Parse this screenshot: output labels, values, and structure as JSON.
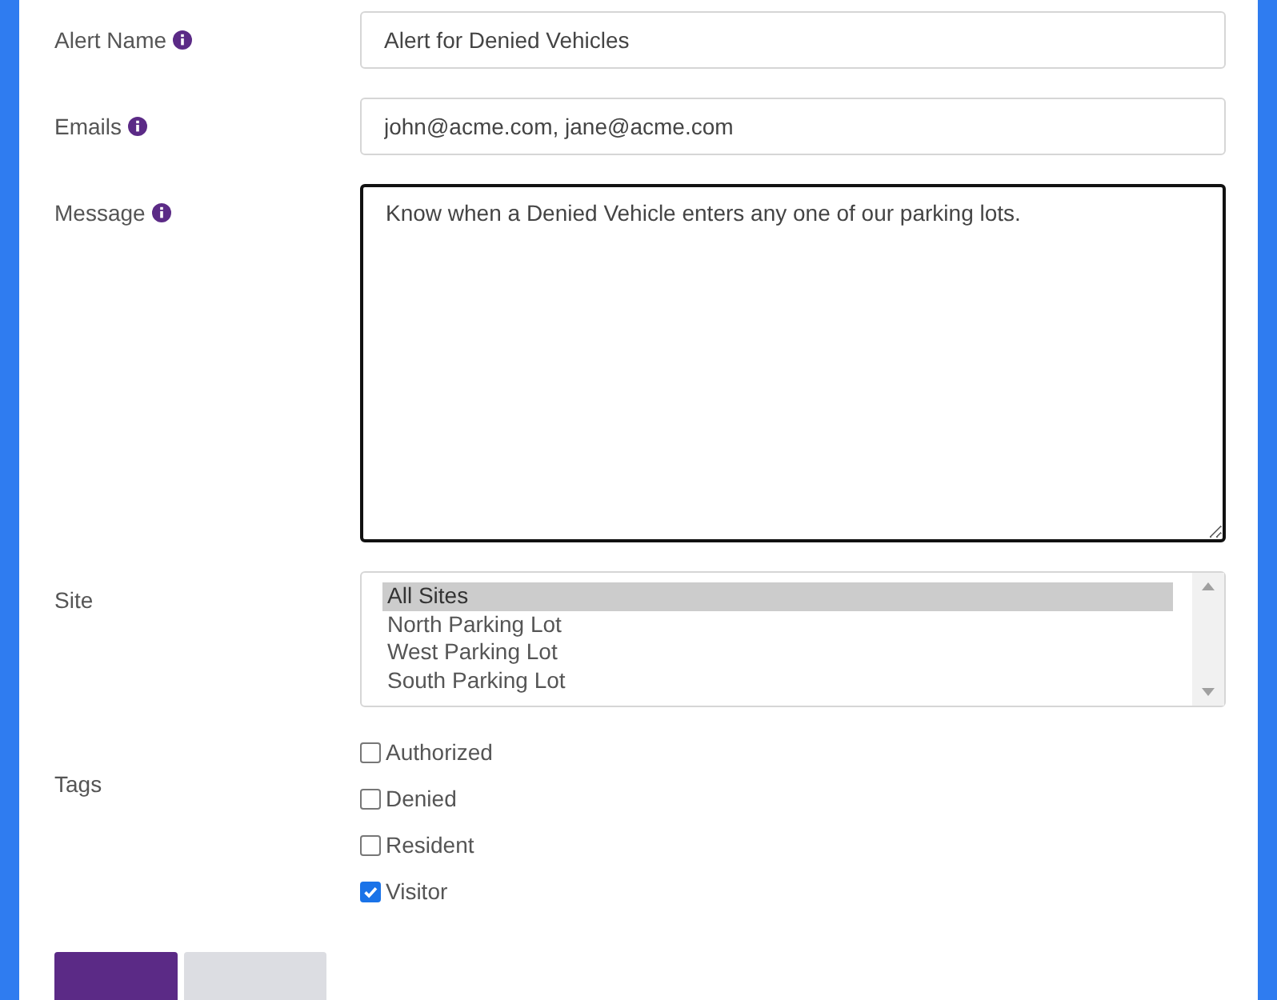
{
  "fields": [
    {
      "kind": "input",
      "label": "Alert Name",
      "info": true,
      "value": "Alert for Denied Vehicles",
      "focused": false
    },
    {
      "kind": "input",
      "label": "Emails",
      "info": true,
      "value": "john@acme.com, jane@acme.com",
      "focused": false
    },
    {
      "kind": "textarea",
      "label": "Message",
      "info": true,
      "value": "Know when a Denied Vehicle enters any one of our parking lots.",
      "focused": true
    },
    {
      "kind": "listbox",
      "label": "Site",
      "info": false,
      "options": [
        {
          "label": "All Sites",
          "selected": true
        },
        {
          "label": "North Parking Lot",
          "selected": false
        },
        {
          "label": "West Parking Lot",
          "selected": false
        },
        {
          "label": "South Parking Lot",
          "selected": false
        }
      ]
    },
    {
      "kind": "checkboxes",
      "label": "Tags",
      "info": false,
      "options": [
        {
          "label": "Authorized",
          "checked": false
        },
        {
          "label": "Denied",
          "checked": false
        },
        {
          "label": "Resident",
          "checked": false
        },
        {
          "label": "Visitor",
          "checked": true
        }
      ]
    }
  ],
  "buttons": [
    {
      "kind": "primary"
    },
    {
      "kind": "secondary"
    }
  ]
}
